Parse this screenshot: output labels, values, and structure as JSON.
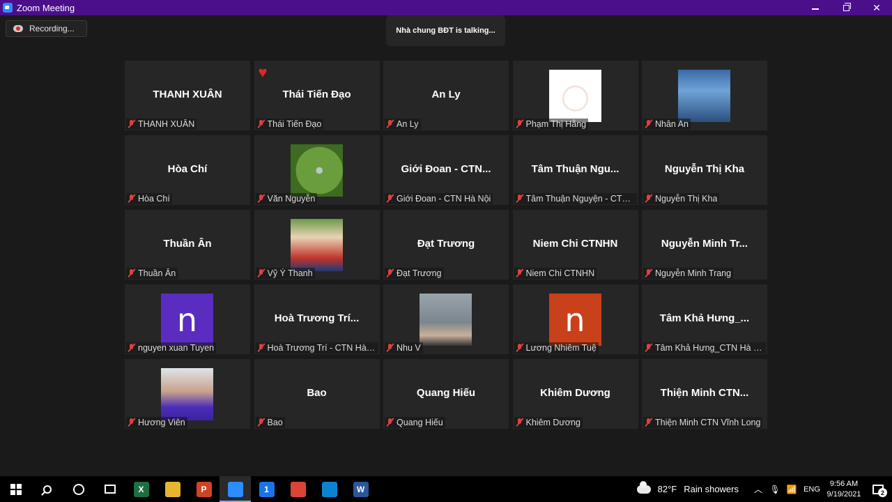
{
  "window": {
    "title": "Zoom Meeting"
  },
  "recording": {
    "label": "Recording..."
  },
  "speaker": {
    "text": "Nhà chung BĐT is talking..."
  },
  "participants": [
    {
      "display": "THANH XUÂN",
      "name": "THANH XUÂN",
      "type": "text"
    },
    {
      "display": "Thái Tiến Đạo",
      "name": "Thái Tiến Đạo",
      "type": "text",
      "reaction": "heart"
    },
    {
      "display": "An Ly",
      "name": "An Ly",
      "type": "text"
    },
    {
      "display": "",
      "name": "Phạm Thị Hằng",
      "type": "photo",
      "photo": "bunny"
    },
    {
      "display": "",
      "name": "Nhân An",
      "type": "photo",
      "photo": "forest"
    },
    {
      "display": "Hòa Chí",
      "name": "Hòa Chí",
      "type": "text"
    },
    {
      "display": "",
      "name": "Văn Nguyễn",
      "type": "photo",
      "photo": "leaf"
    },
    {
      "display": "Giới Đoan - CTN...",
      "name": "Giới Đoan - CTN Hà Nội",
      "type": "text"
    },
    {
      "display": "Tâm Thuận Ngu...",
      "name": "Tâm Thuận Nguyện - CTN ...",
      "type": "text"
    },
    {
      "display": "Nguyễn Thị Kha",
      "name": "Nguyễn Thị Kha",
      "type": "text"
    },
    {
      "display": "Thuần Ân",
      "name": "Thuần Ân",
      "type": "text"
    },
    {
      "display": "",
      "name": "Vỹ Ý Thanh",
      "type": "photo",
      "photo": "girl"
    },
    {
      "display": "Đạt Trương",
      "name": "Đạt Trương",
      "type": "text"
    },
    {
      "display": "Niem Chi CTNHN",
      "name": "Niem Chi CTNHN",
      "type": "text"
    },
    {
      "display": "Nguyễn Minh Tr...",
      "name": "Nguyễn Minh Trang",
      "type": "text"
    },
    {
      "display": "",
      "name": "nguyen xuan Tuyen",
      "type": "letter",
      "letter": "n",
      "color": "#5b2cc0"
    },
    {
      "display": "Hoà Trương Trí...",
      "name": "Hoà Trương Trí - CTN Hà ...",
      "type": "text"
    },
    {
      "display": "",
      "name": "Nhu V",
      "type": "photo",
      "photo": "city"
    },
    {
      "display": "",
      "name": "Lương Nhiêm Tuệ",
      "type": "letter",
      "letter": "n",
      "color": "#c8411a"
    },
    {
      "display": "Tâm Khả Hưng_...",
      "name": "Tâm Khả Hưng_CTN Hà Nội",
      "type": "text"
    },
    {
      "display": "",
      "name": "Hương Viên",
      "type": "photo",
      "photo": "woman"
    },
    {
      "display": "Bao",
      "name": "Bao",
      "type": "text"
    },
    {
      "display": "Quang Hiếu",
      "name": "Quang Hiếu",
      "type": "text"
    },
    {
      "display": "Khiêm Dương",
      "name": "Khiêm Dương",
      "type": "text"
    },
    {
      "display": "Thiện Minh CTN...",
      "name": "Thiện Minh CTN Vĩnh Long",
      "type": "text"
    }
  ],
  "taskbar": {
    "apps": [
      {
        "icon": "excel-icon",
        "letter": "X",
        "color": "#1d6f42"
      },
      {
        "icon": "file-explorer-icon",
        "letter": "",
        "color": "#e8b530"
      },
      {
        "icon": "powerpoint-icon",
        "letter": "P",
        "color": "#d04423"
      },
      {
        "icon": "zoom-icon",
        "letter": "",
        "color": "#2d8cff",
        "active": true
      },
      {
        "icon": "outlook-icon",
        "letter": "1",
        "color": "#1a73e8"
      },
      {
        "icon": "chrome-icon",
        "letter": "",
        "color": "#db4437"
      },
      {
        "icon": "edge-icon",
        "letter": "",
        "color": "#0a84d0"
      },
      {
        "icon": "word-icon",
        "letter": "W",
        "color": "#2b579a"
      }
    ],
    "weather": {
      "temp": "82°F",
      "desc": "Rain showers"
    },
    "lang": "ENG",
    "time": "9:56 AM",
    "date": "9/19/2021",
    "notifications": "2"
  }
}
